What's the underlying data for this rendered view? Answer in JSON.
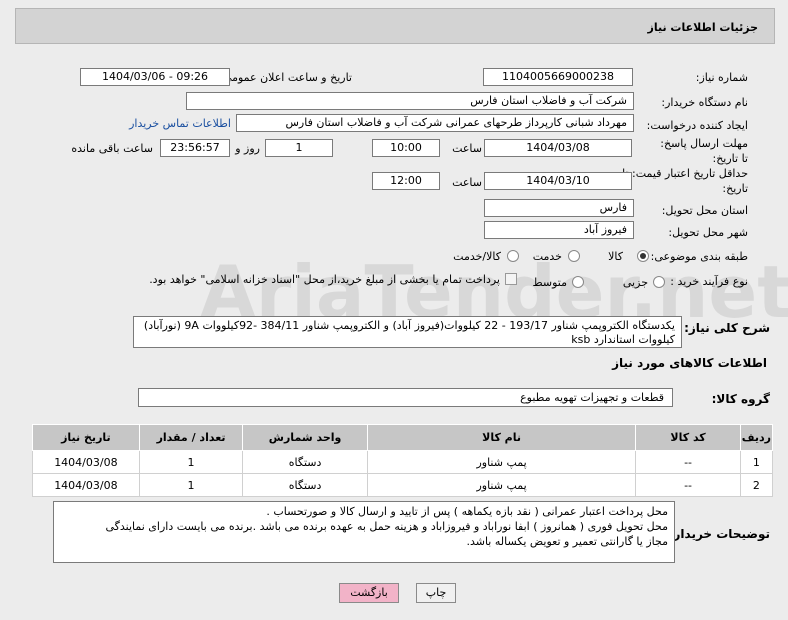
{
  "header": {
    "title": "جزئیات اطلاعات نیاز"
  },
  "watermark": "AriaTender.net",
  "fields": {
    "need_number_label": "شماره نیاز:",
    "need_number": "1104005669000238",
    "announce_label": "تاریخ و ساعت اعلان عمومی:",
    "announce_value": "1404/03/06 - 09:26",
    "buyer_label": "نام دستگاه خریدار:",
    "buyer": "شرکت آب و فاضلاب استان فارس",
    "creator_label": "ایجاد کننده درخواست:",
    "creator": "مهرداد شبانی کارپرداز طرحهای عمرانی  شرکت آب و فاضلاب استان فارس",
    "contact_link": "اطلاعات تماس خریدار",
    "deadline_label": "مهلت ارسال پاسخ: تا تاریخ:",
    "deadline_date": "1404/03/08",
    "time_label": "ساعت",
    "deadline_time": "10:00",
    "days_value": "1",
    "days_label": "روز و",
    "remaining_time": "23:56:57",
    "remaining_label": "ساعت باقی مانده",
    "price_label": "حداقل تاریخ اعتبار قیمت: تا تاریخ:",
    "price_date": "1404/03/10",
    "price_time": "12:00",
    "province_label": "استان محل تحویل:",
    "province": "فارس",
    "city_label": "شهر محل تحویل:",
    "city": "فیروز آباد",
    "category_label": "طبقه بندی موضوعی:",
    "cat_goods": "کالا",
    "cat_service": "خدمت",
    "cat_goods_service": "کالا/خدمت",
    "process_label": "نوع فرآیند خرید :",
    "proc_partial": "جزیی",
    "proc_medium": "متوسط",
    "payment_note": "پرداخت تمام یا بخشی از مبلغ خرید،از محل \"اسناد خزانه اسلامی\" خواهد بود."
  },
  "description": {
    "label": "شرح کلی نیاز:",
    "text": "یکدستگاه الکتروپمپ شناور 193/17 - 22 کیلووات(فیروز آباد) و الکتروپمپ شناور 384/11  -92کیلووات 9A (نورآباد) کیلووات استاندارد ksb"
  },
  "goods": {
    "section_title": "اطلاعات کالاهای مورد نیاز",
    "group_label": "گروه کالا:",
    "group_value": "قطعات و تجهیزات تهویه مطبوع",
    "columns": [
      "ردیف",
      "کد کالا",
      "نام کالا",
      "واحد شمارش",
      "تعداد / مقدار",
      "تاریخ نیاز"
    ],
    "rows": [
      [
        "1",
        "--",
        "پمپ شناور",
        "دستگاه",
        "1",
        "1404/03/08"
      ],
      [
        "2",
        "--",
        "پمپ شناور",
        "دستگاه",
        "1",
        "1404/03/08"
      ]
    ]
  },
  "notes": {
    "label": "توضیحات خریدار:",
    "lines": [
      "محل پرداخت اعتبار عمرانی  ( نقد بازه یکماهه ) پس از تایید  و ارسال کالا و صورتحساب .",
      "محل تحویل فوری ( همانروز ) ابفا نوراباد و فیروزاباد   و هزینه حمل به عهده برنده می باشد .برنده می بایست دارای نمایندگی",
      "مجاز یا گارانتی  تعمیر و تعویض یکساله باشد."
    ]
  },
  "buttons": {
    "print": "چاپ",
    "back": "بازگشت"
  }
}
